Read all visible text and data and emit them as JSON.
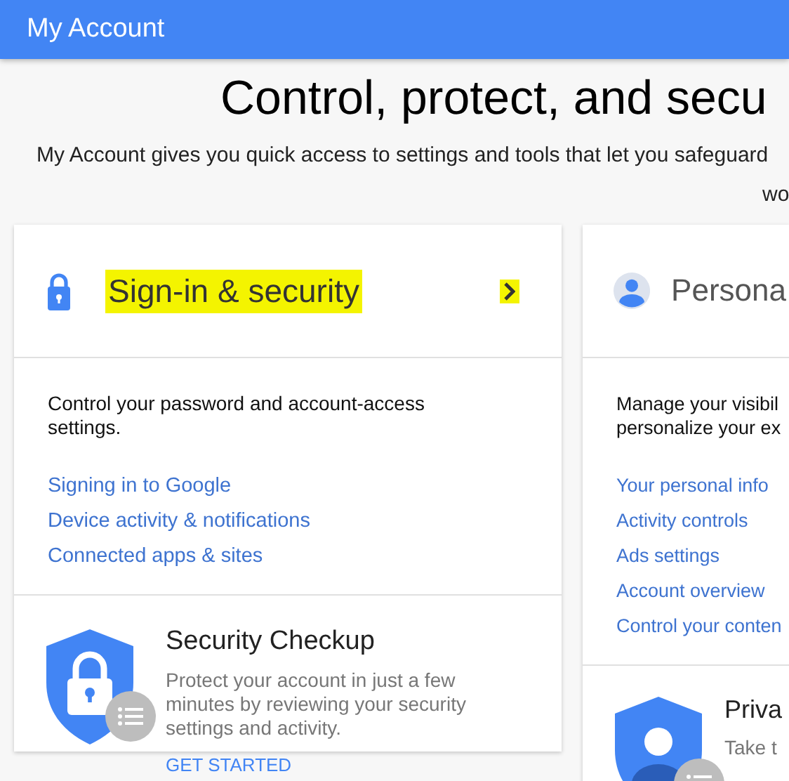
{
  "app_bar": {
    "title": "My Account"
  },
  "headline": "Control, protect, and secu",
  "intro": [
    "My Account gives you quick access to settings and tools that let you safeguard",
    "wo"
  ],
  "cards": [
    {
      "kind": "security",
      "title": "Sign-in & security",
      "highlighted": true,
      "chevron": true,
      "description": [
        "Control your password and account-access",
        "settings."
      ],
      "links": [
        "Signing in to Google",
        "Device activity & notifications",
        "Connected apps & sites"
      ],
      "feature": {
        "title": "Security Checkup",
        "description": [
          "Protect your account in just a few",
          "minutes by reviewing your security",
          "settings and activity."
        ],
        "action": "GET STARTED"
      }
    },
    {
      "kind": "personal",
      "title": "Persona",
      "highlighted": false,
      "chevron": false,
      "description": [
        "Manage your visibil",
        "personalize your ex"
      ],
      "links": [
        "Your personal info",
        "Activity controls",
        "Ads settings",
        "Account overview",
        "Control your conten"
      ],
      "feature": {
        "title": "Priva",
        "description": [
          "Take t"
        ]
      }
    }
  ]
}
